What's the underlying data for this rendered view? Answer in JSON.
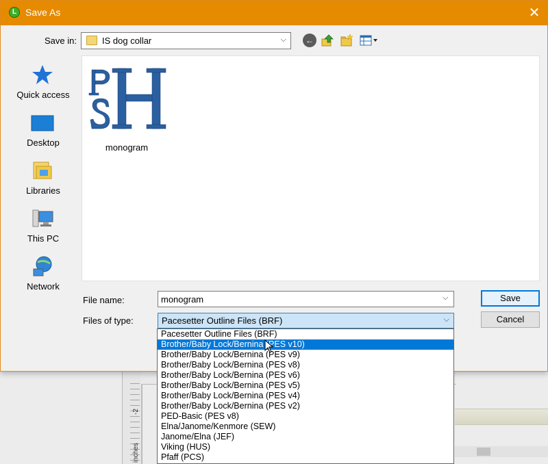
{
  "window": {
    "title": "Save As",
    "close_glyph": "✕"
  },
  "toolbar": {
    "save_in_label": "Save in:",
    "save_in_value": "IS dog collar",
    "icons": [
      "back-icon",
      "up-folder-icon",
      "new-folder-icon",
      "view-menu-icon"
    ]
  },
  "places": [
    {
      "label": "Quick access",
      "icon": "star-icon"
    },
    {
      "label": "Desktop",
      "icon": "desktop-icon"
    },
    {
      "label": "Libraries",
      "icon": "libraries-icon"
    },
    {
      "label": "This PC",
      "icon": "computer-icon"
    },
    {
      "label": "Network",
      "icon": "network-icon"
    }
  ],
  "files": [
    {
      "name": "monogram"
    }
  ],
  "form": {
    "file_name_label": "File name:",
    "file_name_value": "monogram",
    "file_type_label": "Files of type:",
    "file_type_value": "Pacesetter Outline Files (BRF)"
  },
  "buttons": {
    "save": "Save",
    "cancel": "Cancel"
  },
  "file_type_options": [
    "Pacesetter Outline Files (BRF)",
    "Brother/Baby Lock/Bernina (PES v10)",
    "Brother/Baby Lock/Bernina (PES v9)",
    "Brother/Baby Lock/Bernina (PES v8)",
    "Brother/Baby Lock/Bernina (PES v6)",
    "Brother/Baby Lock/Bernina (PES v5)",
    "Brother/Baby Lock/Bernina (PES v4)",
    "Brother/Baby Lock/Bernina (PES v2)",
    "PED-Basic (PES v8)",
    "Elna/Janome/Kenmore (SEW)",
    "Janome/Elna (JEF)",
    "Viking (HUS)",
    "Pfaff (PCS)"
  ],
  "highlighted_option_index": 1,
  "background": {
    "ruler_labels": [
      "inches",
      "-2"
    ]
  },
  "colors": {
    "titlebar": "#e68a00",
    "selection": "#0078d7",
    "monogram": "#2a5fa0"
  }
}
